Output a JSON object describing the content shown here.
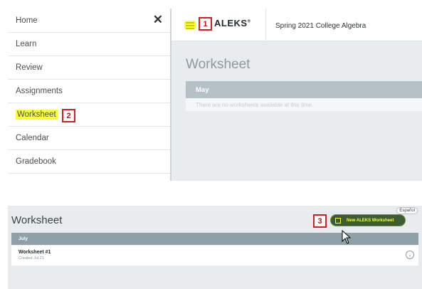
{
  "sidebar": {
    "items": [
      {
        "label": "Home"
      },
      {
        "label": "Learn"
      },
      {
        "label": "Review"
      },
      {
        "label": "Assignments"
      },
      {
        "label": "Worksheet"
      },
      {
        "label": "Calendar"
      },
      {
        "label": "Gradebook"
      }
    ],
    "close_glyph": "✕"
  },
  "annotations": {
    "step1": "1",
    "step2": "2",
    "step3": "3",
    "highlight_color": "#f6ff3a",
    "box_color": "#d02020"
  },
  "header": {
    "logo_text": "ALEKS",
    "logo_mark": "®",
    "course_title": "Spring 2021 College Algebra",
    "menu_icon": "hamburger-menu-icon"
  },
  "main_top": {
    "title": "Worksheet",
    "month": "May",
    "empty_message": "There are no worksheets available at this time."
  },
  "main_bottom": {
    "title": "Worksheet",
    "language_link": "Español",
    "new_button_label": "New ALEKS Worksheet",
    "month": "July",
    "worksheets": [
      {
        "name": "Worksheet #1",
        "created": "Created Jul 21"
      }
    ],
    "accent": "#3b5d2f"
  }
}
